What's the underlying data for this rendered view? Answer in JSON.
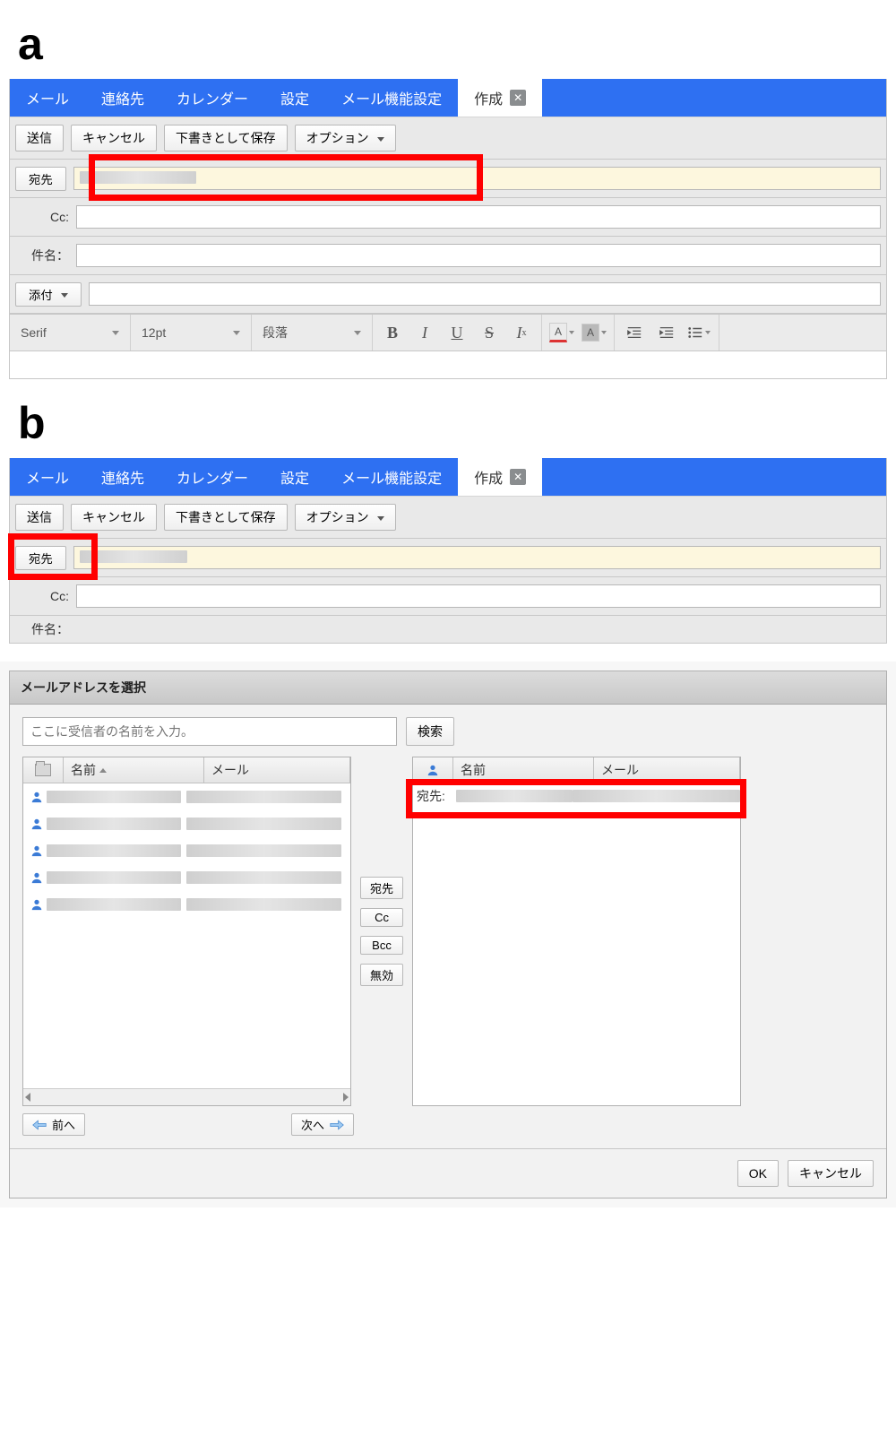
{
  "labels": {
    "a": "a",
    "b": "b"
  },
  "tabs": {
    "mail": "メール",
    "contacts": "連絡先",
    "calendar": "カレンダー",
    "settings": "設定",
    "mail_settings": "メール機能設定",
    "compose": "作成"
  },
  "toolbar": {
    "send": "送信",
    "cancel": "キャンセル",
    "save_draft": "下書きとして保存",
    "options": "オプション"
  },
  "fields": {
    "to": "宛先",
    "cc": "Cc:",
    "subject": "件名：",
    "attach": "添付"
  },
  "editor": {
    "font": "Serif",
    "size": "12pt",
    "para": "段落"
  },
  "dialog": {
    "title": "メールアドレスを選択",
    "search_placeholder": "ここに受信者の名前を入力。",
    "search_btn": "検索",
    "col_name": "名前",
    "col_mail": "メール",
    "btn_to": "宛先",
    "btn_cc": "Cc",
    "btn_bcc": "Bcc",
    "btn_disable": "無効",
    "prev": "前へ",
    "next": "次へ",
    "ok": "OK",
    "cancel": "キャンセル",
    "selected_to_label": "宛先:"
  }
}
